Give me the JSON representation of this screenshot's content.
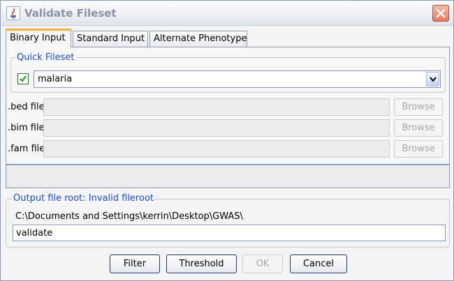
{
  "window": {
    "title": "Validate Fileset"
  },
  "tabs": [
    "Binary Input",
    "Standard Input",
    "Alternate Phenotype"
  ],
  "quick_fileset": {
    "label": "Quick Fileset",
    "checked": true,
    "selected": "malaria"
  },
  "files": [
    {
      "label": ".bed file",
      "value": "",
      "browse": "Browse"
    },
    {
      "label": ".bim file",
      "value": "",
      "browse": "Browse"
    },
    {
      "label": ".fam file",
      "value": "",
      "browse": "Browse"
    }
  ],
  "output": {
    "label": "Output file root: Invalid fileroot",
    "path": "C:\\Documents and Settings\\kerrin\\Desktop\\GWAS\\",
    "value": "validate"
  },
  "buttons": {
    "filter": "Filter",
    "threshold": "Threshold",
    "ok": "OK",
    "cancel": "Cancel"
  },
  "colors": {
    "accent": "#1c4fc4",
    "active_tab": "#f2b43a",
    "check": "#2e9b2e",
    "close": "#e3775f"
  }
}
